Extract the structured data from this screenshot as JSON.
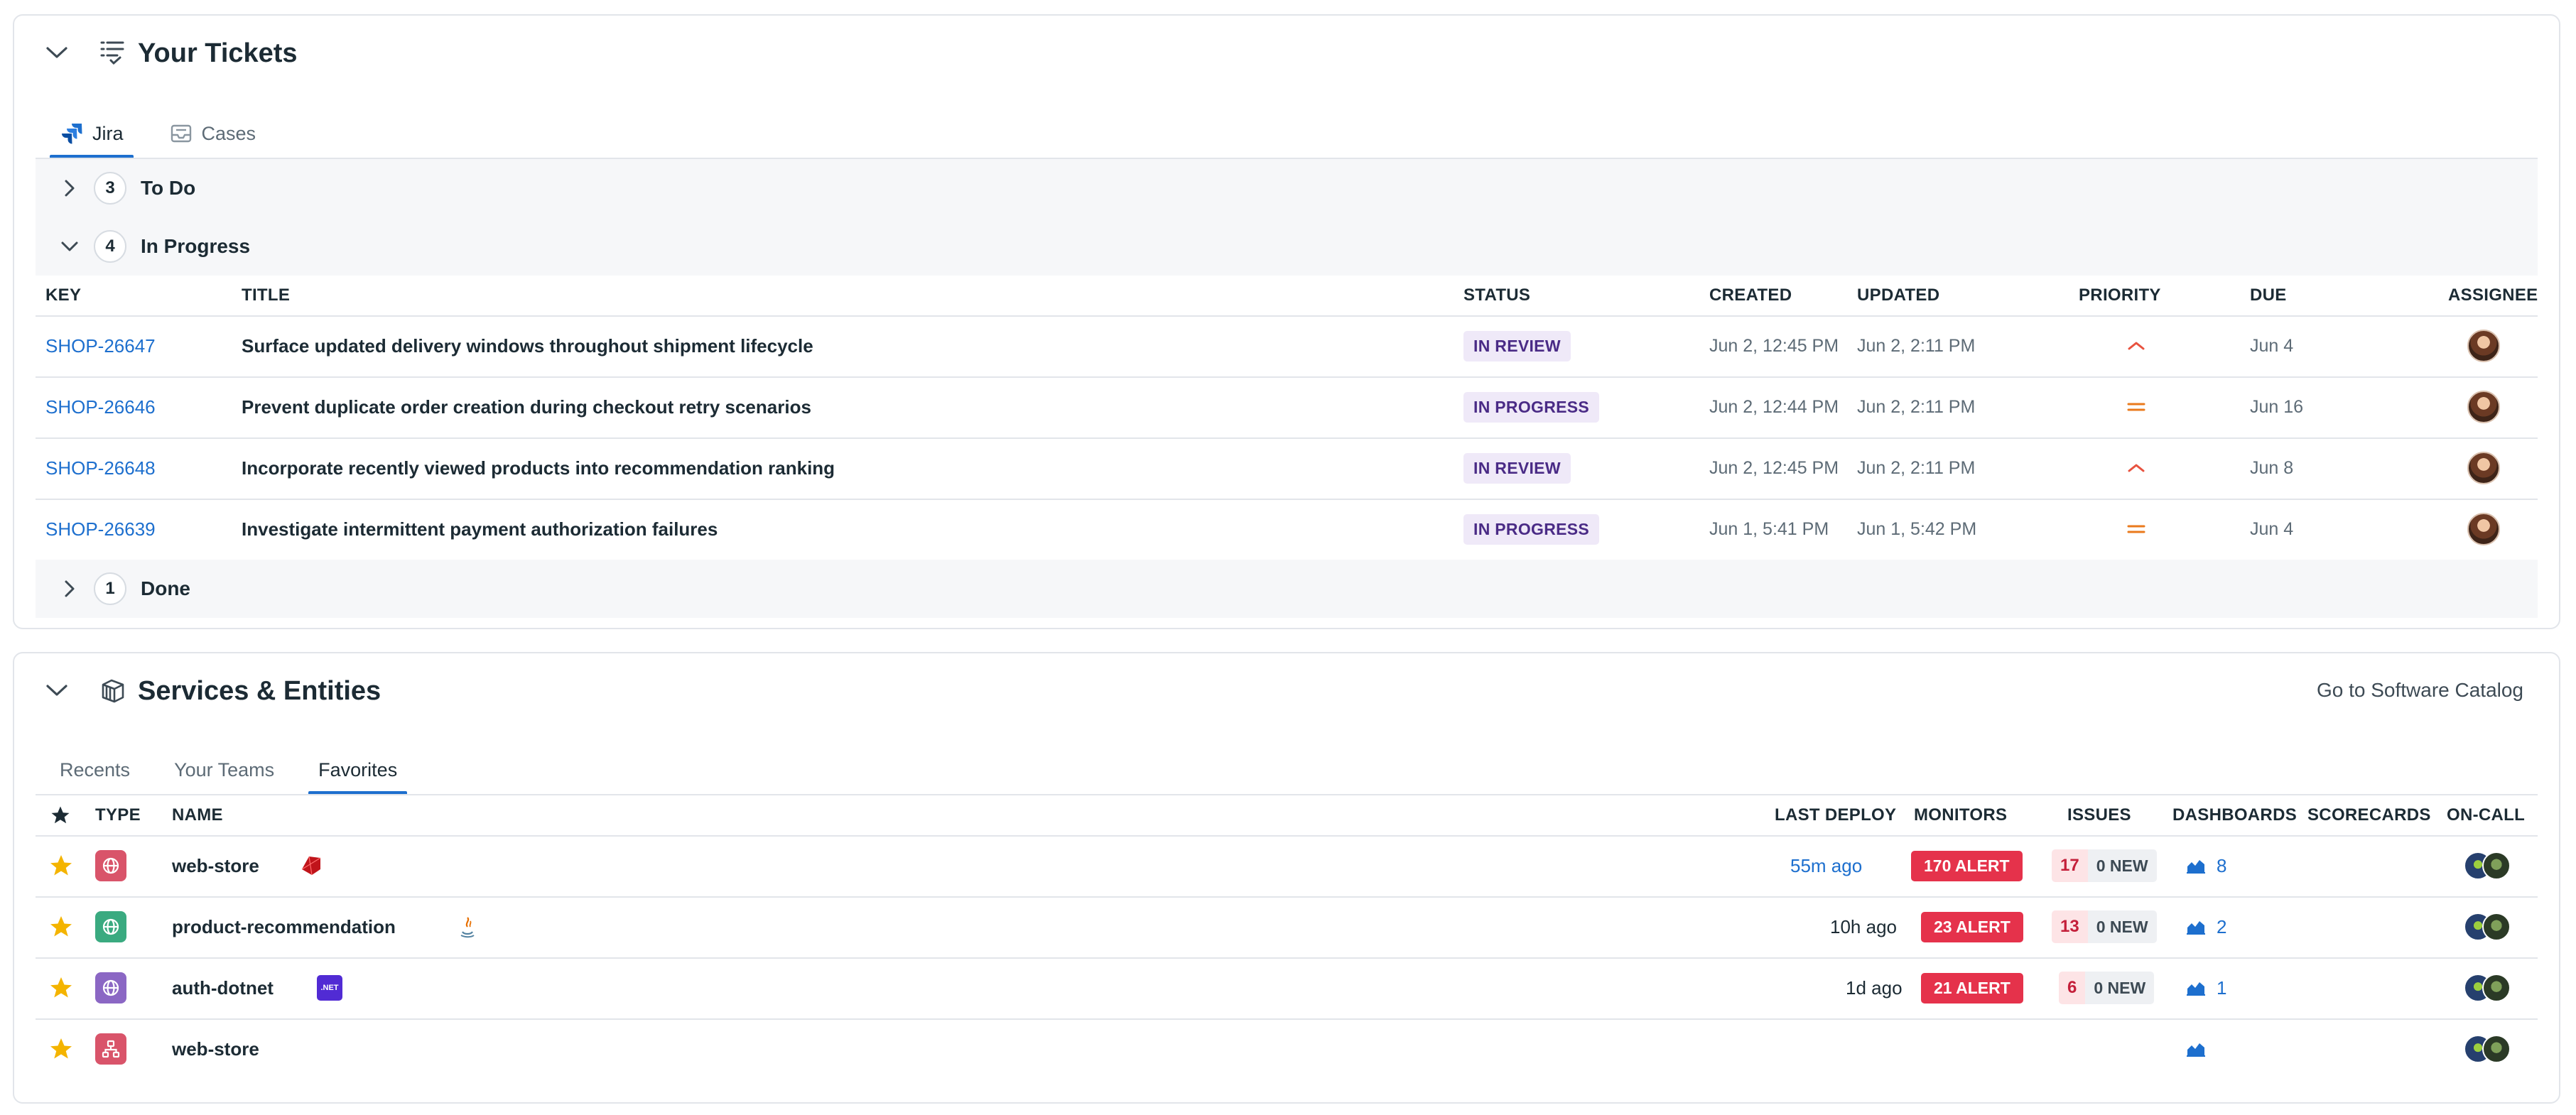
{
  "tickets": {
    "title": "Your Tickets",
    "tabs": [
      {
        "label": "Jira",
        "active": true
      },
      {
        "label": "Cases",
        "active": false
      }
    ],
    "groups": {
      "todo": {
        "count": "3",
        "label": "To Do"
      },
      "in_progress": {
        "count": "4",
        "label": "In Progress"
      },
      "done": {
        "count": "1",
        "label": "Done"
      }
    },
    "columns": [
      "KEY",
      "TITLE",
      "STATUS",
      "CREATED",
      "UPDATED",
      "PRIORITY",
      "DUE",
      "ASSIGNEE"
    ],
    "rows": [
      {
        "key": "SHOP-26647",
        "title": "Surface updated delivery windows throughout shipment lifecycle",
        "status": "IN REVIEW",
        "created": "Jun 2, 12:45 PM",
        "updated": "Jun 2, 2:11 PM",
        "priority": "high",
        "due": "Jun 4"
      },
      {
        "key": "SHOP-26646",
        "title": "Prevent duplicate order creation during checkout retry scenarios",
        "status": "IN PROGRESS",
        "created": "Jun 2, 12:44 PM",
        "updated": "Jun 2, 2:11 PM",
        "priority": "medium",
        "due": "Jun 16"
      },
      {
        "key": "SHOP-26648",
        "title": "Incorporate recently viewed products into recommendation ranking",
        "status": "IN REVIEW",
        "created": "Jun 2, 12:45 PM",
        "updated": "Jun 2, 2:11 PM",
        "priority": "high",
        "due": "Jun 8"
      },
      {
        "key": "SHOP-26639",
        "title": "Investigate intermittent payment authorization failures",
        "status": "IN PROGRESS",
        "created": "Jun 1, 5:41 PM",
        "updated": "Jun 1, 5:42 PM",
        "priority": "medium",
        "due": "Jun 4"
      }
    ]
  },
  "services": {
    "title": "Services & Entities",
    "catalog_link": "Go to Software Catalog",
    "tabs": [
      {
        "label": "Recents",
        "active": false
      },
      {
        "label": "Your Teams",
        "active": false
      },
      {
        "label": "Favorites",
        "active": true
      }
    ],
    "columns": [
      "TYPE",
      "NAME",
      "LAST DEPLOY",
      "MONITORS",
      "ISSUES",
      "DASHBOARDS",
      "SCORECARDS",
      "ON-CALL"
    ],
    "rows": [
      {
        "name": "web-store",
        "type_color": "#d9546a",
        "tech": "ruby-icon",
        "last_deploy": "55m ago",
        "deploy_link": true,
        "monitors": "170 ALERT",
        "issues": "17",
        "issues_new": "0 NEW",
        "dashboards": "8"
      },
      {
        "name": "product-recommendation",
        "type_color": "#3aaa80",
        "tech": "java-icon",
        "last_deploy": "10h ago",
        "deploy_link": false,
        "monitors": "23 ALERT",
        "issues": "13",
        "issues_new": "0 NEW",
        "dashboards": "2"
      },
      {
        "name": "auth-dotnet",
        "type_color": "#8b67c4",
        "tech": "dotnet-icon",
        "dotnet_label": ".NET",
        "last_deploy": "1d ago",
        "deploy_link": false,
        "monitors": "21 ALERT",
        "issues": "6",
        "issues_new": "0 NEW",
        "dashboards": "1"
      },
      {
        "name": "web-store",
        "type_color": "#d9546a",
        "tech": "",
        "last_deploy": "",
        "deploy_link": false,
        "monitors": "",
        "issues": "",
        "issues_new": "",
        "dashboards": ""
      }
    ]
  },
  "colors": {
    "link": "#1d6fce",
    "alert": "#e5324b",
    "star": "#f4b400",
    "priority_high": "#e8523f",
    "priority_medium": "#ea7a1c"
  }
}
